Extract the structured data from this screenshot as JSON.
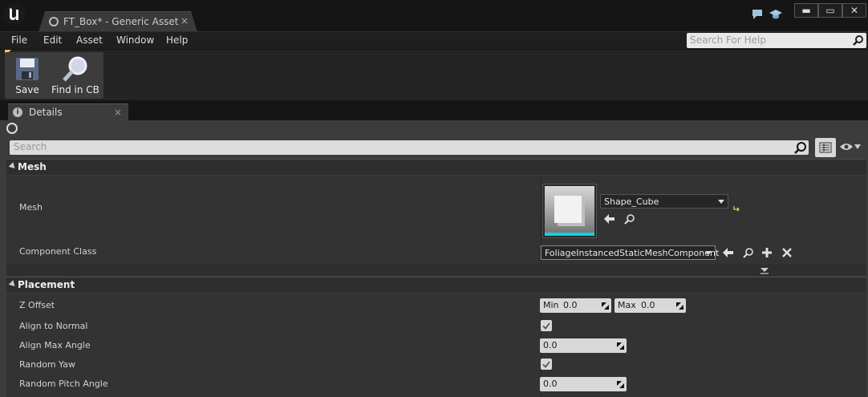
{
  "window": {
    "tab_title": "FT_Box* - Generic Asset Ed",
    "tab_close": "×",
    "controls": {
      "minimize": "▬",
      "maximize": "▭",
      "close": "✕"
    }
  },
  "menu": {
    "items": [
      "File",
      "Edit",
      "Asset",
      "Window",
      "Help"
    ],
    "help_search_placeholder": "Search For Help"
  },
  "toolbar": {
    "save_label": "Save",
    "find_label": "Find in CB"
  },
  "details": {
    "tab_label": "Details",
    "tab_close": "×",
    "search_placeholder": "Search",
    "mesh_category": {
      "label": "Mesh",
      "mesh_label": "Mesh",
      "mesh_value": "Shape_Cube",
      "component_class_label": "Component Class",
      "component_class_value": "FoliageInstancedStaticMeshComponent"
    },
    "placement_category": {
      "label": "Placement",
      "z_offset_label": "Z Offset",
      "z_offset_min_label": "Min",
      "z_offset_min": "0.0",
      "z_offset_max_label": "Max",
      "z_offset_max": "0.0",
      "align_normal_label": "Align to Normal",
      "align_normal_checked": true,
      "align_max_angle_label": "Align Max Angle",
      "align_max_angle": "0.0",
      "random_yaw_label": "Random Yaw",
      "random_yaw_checked": true,
      "random_pitch_label": "Random Pitch Angle",
      "random_pitch": "0.0"
    }
  },
  "icons": {
    "search": "search-icon",
    "arrow_left": "arrow-left-icon",
    "browse": "browse-icon",
    "add": "plus-icon",
    "clear": "x-icon"
  },
  "colors": {
    "accent_cyan": "#16d0e0",
    "panel_bg": "#3c3c3c",
    "header_bg": "#2e2e2e",
    "warning_yellow": "#e8c84a"
  }
}
